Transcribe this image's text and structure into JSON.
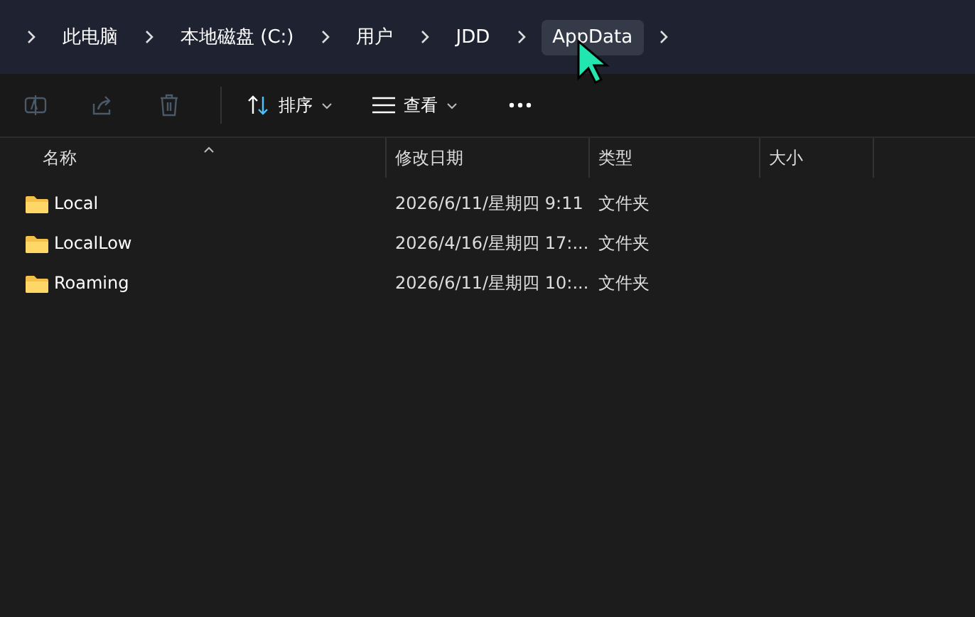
{
  "breadcrumbs": [
    {
      "label": "此电脑",
      "hovered": false
    },
    {
      "label": "本地磁盘 (C:)",
      "hovered": false
    },
    {
      "label": "用户",
      "hovered": false
    },
    {
      "label": "JDD",
      "hovered": false
    },
    {
      "label": "AppData",
      "hovered": true
    }
  ],
  "toolbar": {
    "actions": [
      {
        "kind": "rename",
        "disabled": true
      },
      {
        "kind": "share",
        "disabled": true
      },
      {
        "kind": "delete",
        "disabled": true
      }
    ],
    "sort_button": "排序",
    "view_button": "查看"
  },
  "columns": [
    {
      "label": "名称",
      "sorted": true
    },
    {
      "label": "修改日期",
      "sorted": false
    },
    {
      "label": "类型",
      "sorted": false
    },
    {
      "label": "大小",
      "sorted": false
    }
  ],
  "rows": [
    {
      "name": "Local",
      "modified": "2026/6/11/星期四 9:11",
      "type": "文件夹"
    },
    {
      "name": "LocalLow",
      "modified": "2026/4/16/星期四 17:...",
      "type": "文件夹"
    },
    {
      "name": "Roaming",
      "modified": "2026/6/11/星期四 10:...",
      "type": "文件夹"
    }
  ]
}
